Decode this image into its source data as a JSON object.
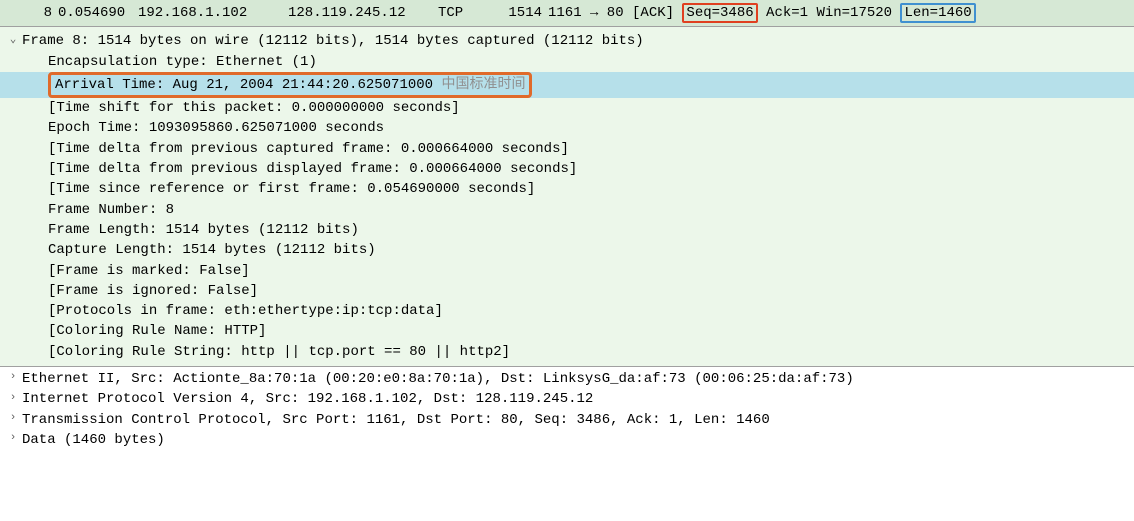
{
  "packetList": {
    "row": {
      "no": "8",
      "time": "0.054690",
      "src": "192.168.1.102",
      "dst": "128.119.245.12",
      "proto": "TCP",
      "length": "1514",
      "info_pre": "1161 → 80 [ACK] ",
      "info_seq": "Seq=3486",
      "info_mid": " Ack=1 Win=17520 ",
      "info_len": "Len=1460"
    }
  },
  "frame": {
    "summary": "Frame 8: 1514 bytes on wire (12112 bits), 1514 bytes captured (12112 bits)",
    "encap": "Encapsulation type: Ethernet (1)",
    "arrival_main": "Arrival Time: Aug 21, 2004 21:44:20.625071000 ",
    "arrival_tz": "中国标准时间",
    "timeshift": "[Time shift for this packet: 0.000000000 seconds]",
    "epoch": "Epoch Time: 1093095860.625071000 seconds",
    "delta_cap": "[Time delta from previous captured frame: 0.000664000 seconds]",
    "delta_disp": "[Time delta from previous displayed frame: 0.000664000 seconds]",
    "since_ref": "[Time since reference or first frame: 0.054690000 seconds]",
    "number": "Frame Number: 8",
    "length": "Frame Length: 1514 bytes (12112 bits)",
    "caplen": "Capture Length: 1514 bytes (12112 bits)",
    "marked": "[Frame is marked: False]",
    "ignored": "[Frame is ignored: False]",
    "protos": "[Protocols in frame: eth:ethertype:ip:tcp:data]",
    "color_name": "[Coloring Rule Name: HTTP]",
    "color_string": "[Coloring Rule String: http || tcp.port == 80 || http2]"
  },
  "protocols": {
    "eth": "Ethernet II, Src: Actionte_8a:70:1a (00:20:e0:8a:70:1a), Dst: LinksysG_da:af:73 (00:06:25:da:af:73)",
    "ip": "Internet Protocol Version 4, Src: 192.168.1.102, Dst: 128.119.245.12",
    "tcp": "Transmission Control Protocol, Src Port: 1161, Dst Port: 80, Seq: 3486, Ack: 1, Len: 1460",
    "data": "Data (1460 bytes)"
  },
  "glyph": {
    "expanded": "⌄",
    "collapsed": "›"
  }
}
